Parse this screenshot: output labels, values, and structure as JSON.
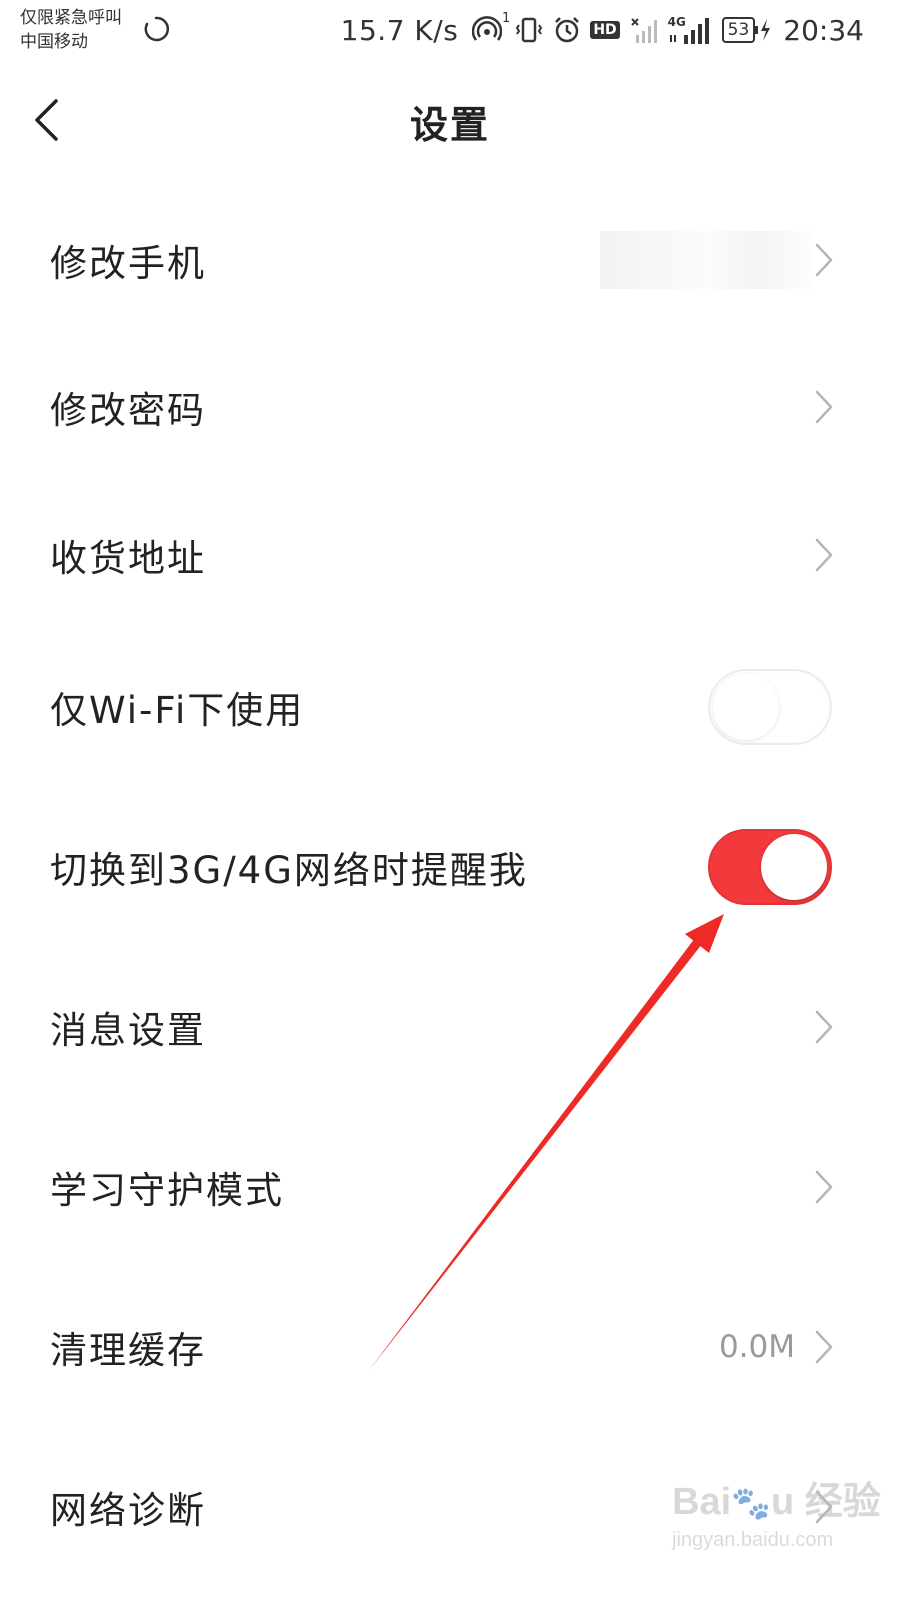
{
  "status_bar": {
    "carrier_line1": "仅限紧急呼叫",
    "carrier_line2": "中国移动",
    "net_speed": "15.7 K/s",
    "hotspot_sup": "1",
    "hd_badge": "HD",
    "network_type": "4G",
    "battery": "53",
    "time": "20:34"
  },
  "header": {
    "title": "设置"
  },
  "rows": [
    {
      "label": "修改手机"
    },
    {
      "label": "修改密码"
    },
    {
      "label": "收货地址"
    },
    {
      "label": "仅Wi-Fi下使用",
      "toggle_on": false
    },
    {
      "label": "切换到3G/4G网络时提醒我",
      "toggle_on": true
    },
    {
      "label": "消息设置"
    },
    {
      "label": "学习守护模式"
    },
    {
      "label": "清理缓存",
      "value": "0.0M"
    },
    {
      "label": "网络诊断"
    }
  ],
  "colors": {
    "accent": "#f23a3c",
    "annotation": "#ee2a26",
    "chevron": "#b5b5b5"
  },
  "watermark": {
    "brand_text": "Baidu经验",
    "url_text": "jingyan.baidu.com"
  }
}
